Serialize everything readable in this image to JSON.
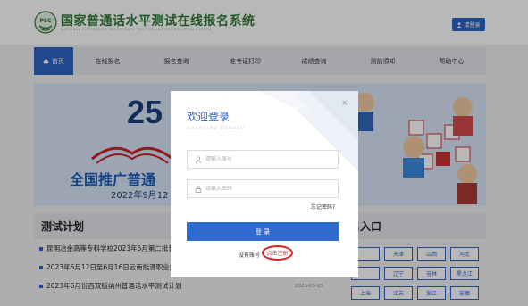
{
  "header": {
    "site_title": "国家普通话水平测试在线报名系统",
    "site_subtitle": "NATIONAL PUTONGHUA PROFICIENCY TEST ONLINE REGISTRATION SYSTEM",
    "logo_text": "PSC",
    "login_button": "请登录"
  },
  "nav": {
    "items": [
      "首页",
      "在线报名",
      "报名查询",
      "准考证打印",
      "成绩查询",
      "测前须知",
      "帮助中心"
    ],
    "active_index": 0
  },
  "banner": {
    "year": "25",
    "title": "全国推广普通",
    "date": "2022年9月12"
  },
  "exam_plan": {
    "heading": "测试计划",
    "items": [
      {
        "text": "昆明冶金高等专科学校2023年5月第二批普",
        "date": ""
      },
      {
        "text": "2023年6月12日至6月16日云南能源职业技",
        "date": ""
      },
      {
        "text": "2023年6月份西双版纳州普通话水平测试计划",
        "date": "2023-05-25"
      }
    ]
  },
  "registration": {
    "heading": "名入口",
    "provinces": [
      "",
      "天津",
      "山西",
      "河北",
      "",
      "辽宁",
      "吉林",
      "黑龙江",
      "上海",
      "江苏",
      "浙江",
      "安徽"
    ]
  },
  "modal": {
    "title": "欢迎登录",
    "subtitle": "HUANYING DENGLU",
    "close": "×",
    "username_placeholder": "请输入账号",
    "password_placeholder": "请输入密码",
    "forgot": "忘记密码?",
    "submit": "登 录",
    "no_account": "没有账号",
    "register": "点击注册"
  },
  "colors": {
    "primary": "#2c64c6",
    "title_green": "#2f7a36",
    "highlight_red": "#e0201c"
  }
}
